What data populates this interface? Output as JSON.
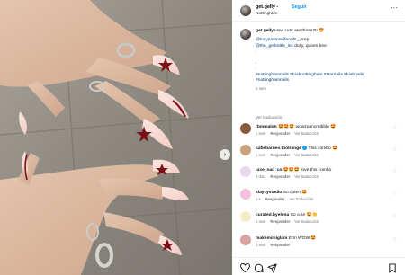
{
  "post": {
    "username": "get.gelly",
    "separator": "•",
    "follow_label": "Seguir",
    "location": "Nottingham",
    "more_icon": "more-horizontal-icon",
    "next_icon": "chevron-right-icon"
  },
  "caption": {
    "username": "get.gelly",
    "text": "How cute are these?!! 🤩",
    "line2_mention": "@lucypastorelifeoofs_",
    "line2_rest": " prep",
    "line3_mention": "@the_gelbottle_inc",
    "line3_rest": " dolly, queen bee",
    "dots": [
      ".",
      ".",
      ".",
      "."
    ],
    "hashtags_line1": "#nottinghamnails #biabnottingham #starnails #biabnails",
    "hashtags_line2": "#nottinghamnails",
    "time": "2 sem"
  },
  "see_translation": "Ver traducción",
  "comments": [
    {
      "username": "rbmmalon",
      "text": "🤩🤩🤩 wowza incredible 🤩",
      "time": "1 sem",
      "reply": "Responder",
      "translate": "Ver traducción",
      "verified": false,
      "avatar_color": "#8a5a3c"
    },
    {
      "username": "katiebarnes.toolrange",
      "text": "This combo 🤩",
      "time": "1 sem",
      "reply": "Responder",
      "translate": "Ver traducción",
      "verified": true,
      "avatar_color": "#c9a27e"
    },
    {
      "username": "luxe_nail_co",
      "text": "🤩🤩🤩 love this combo",
      "time": "3 días",
      "reply": "Responder",
      "translate": "Ver traducción",
      "verified": false,
      "avatar_color": "#e9d9ef"
    },
    {
      "username": "slayzystudio",
      "text": "So cute!! 🤩",
      "time": "1 s",
      "reply": "Responder",
      "translate": "Ver traducción",
      "verified": false,
      "avatar_color": "#f4c0dc"
    },
    {
      "username": "curated.byelena",
      "text": "So cute 🤩👏",
      "time": "1 sem",
      "reply": "Responder",
      "translate": "Ver traducción",
      "verified": false,
      "avatar_color": "#f3edc8"
    },
    {
      "username": "makemimiglam",
      "text": "Erm WOW 🤩",
      "time": "1 sem",
      "reply": "Responder",
      "translate": "",
      "verified": false,
      "avatar_color": "#d8a4a0"
    }
  ],
  "actions": {
    "like_icon": "heart-icon",
    "comment_icon": "comment-icon",
    "share_icon": "send-icon",
    "save_icon": "bookmark-icon"
  },
  "colors": {
    "link": "#00376b",
    "follow": "#0095f6",
    "meta": "#737373"
  }
}
